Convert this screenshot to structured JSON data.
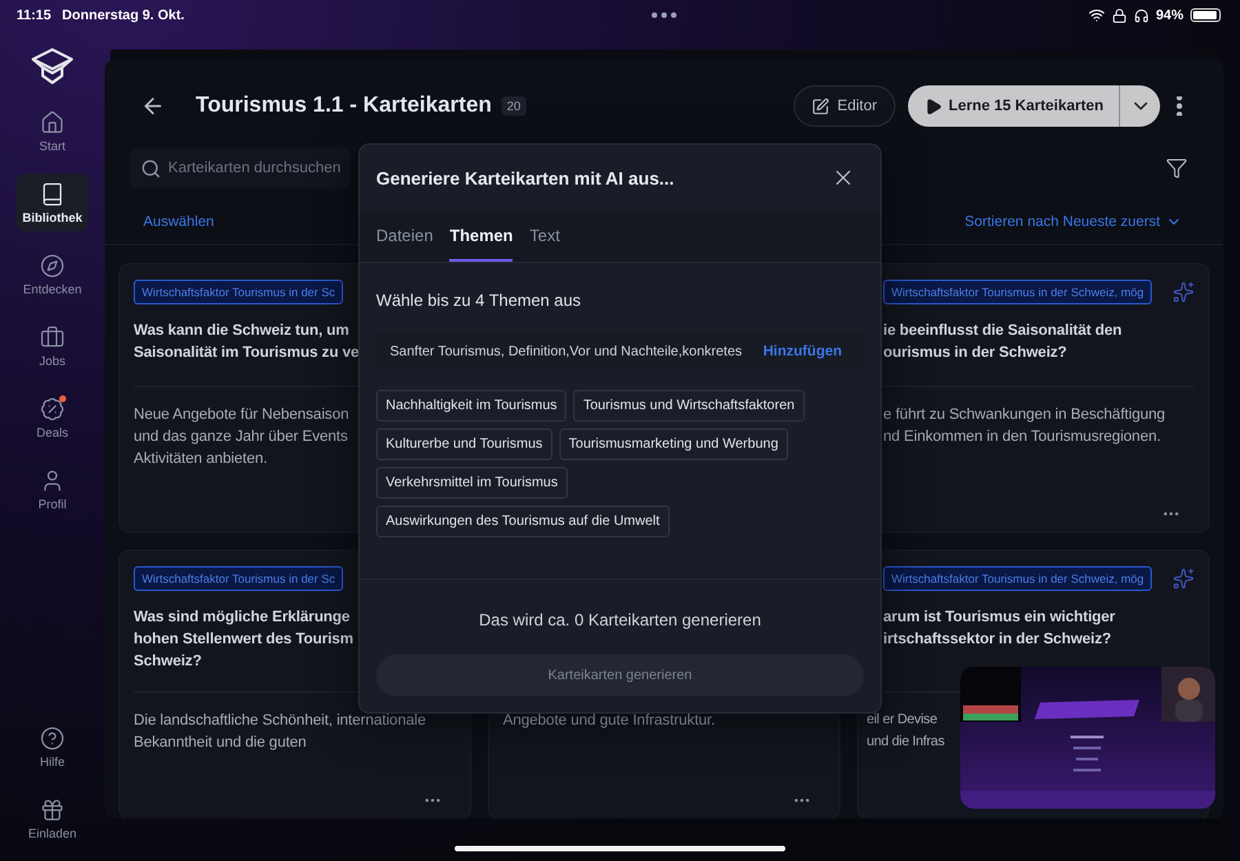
{
  "status_bar": {
    "time": "11:15",
    "date": "Donnerstag 9. Okt.",
    "battery": "94%"
  },
  "sidebar": {
    "items": [
      {
        "label": "Start",
        "selected": false,
        "notification": false
      },
      {
        "label": "Bibliothek",
        "selected": true,
        "notification": false
      },
      {
        "label": "Entdecken",
        "selected": false,
        "notification": false
      },
      {
        "label": "Jobs",
        "selected": false,
        "notification": false
      },
      {
        "label": "Deals",
        "selected": false,
        "notification": true
      },
      {
        "label": "Profil",
        "selected": false,
        "notification": false
      }
    ],
    "footer_items": [
      {
        "label": "Hilfe"
      },
      {
        "label": "Einladen"
      }
    ]
  },
  "header": {
    "title": "Tourismus 1.1 - Karteikarten",
    "count": "20",
    "editor_button": "Editor",
    "learn_button": "Lerne 15 Karteikarten"
  },
  "toolbar": {
    "search_placeholder": "Karteikarten durchsuchen",
    "select_link": "Auswählen",
    "sort_link": "Sortieren nach Neueste zuerst"
  },
  "cards": [
    {
      "kind": "card",
      "tag": "Wirtschaftsfaktor Tourismus in der Sc",
      "question": [
        "Was kann die Schweiz tun, um",
        "Saisonalität im Tourismus zu ve"
      ],
      "answer": [
        "Neue Angebote für Nebensaison",
        "und das ganze Jahr über Events",
        "Aktivitäten anbieten."
      ],
      "sparkle": false,
      "menu": false
    },
    {
      "kind": "covered"
    },
    {
      "kind": "card",
      "tag": "Wirtschaftsfaktor Tourismus in der Schweiz, mög",
      "question": [
        "ie beeinflusst die Saisonalität den",
        "ourismus in der Schweiz?"
      ],
      "answer": [
        "e führt zu Schwankungen in Beschäftigung",
        "nd Einkommen in den Tourismusregionen."
      ],
      "sparkle": true,
      "menu": true
    },
    {
      "kind": "card",
      "tag": "Wirtschaftsfaktor Tourismus in der Sc",
      "question": [
        "Was sind mögliche Erklärunge",
        "hohen Stellenwert des Tourism",
        "Schweiz?"
      ],
      "answer": [
        "Die landschaftliche Schönheit, internationale",
        "Bekanntheit und die guten"
      ],
      "sparkle": false,
      "menu": true
    },
    {
      "kind": "card",
      "answer": [
        "Angebote und gute Infrastruktur."
      ],
      "sparkle": false,
      "menu": true
    },
    {
      "kind": "card",
      "tag": "Wirtschaftsfaktor Tourismus in der Schweiz, mög",
      "question": [
        "arum ist Tourismus ein wichtiger",
        "irtschaftssektor in der Schweiz?"
      ],
      "answer": [
        "eil er Devise",
        "und die Infras"
      ],
      "sparkle": true,
      "menu": false
    }
  ],
  "modal": {
    "title": "Generiere Karteikarten mit AI aus...",
    "tabs": [
      {
        "label": "Dateien",
        "selected": false
      },
      {
        "label": "Themen",
        "selected": true
      },
      {
        "label": "Text",
        "selected": false
      }
    ],
    "prompt": "Wähle bis zu 4 Themen aus",
    "topic_input": {
      "value": "Sanfter Tourismus, Definition,Vor und Nachteile,konkretes"
    },
    "add_button": "Hinzufügen",
    "topics": [
      {
        "label": "Nachhaltigkeit im Tourismus",
        "selected": false
      },
      {
        "label": "Tourismus und Wirtschaftsfaktoren",
        "selected": false
      },
      {
        "label": "Kulturerbe und Tourismus",
        "selected": false
      },
      {
        "label": "Tourismusmarketing und Werbung",
        "selected": false
      },
      {
        "label": "Verkehrsmittel im Tourismus",
        "selected": false
      },
      {
        "label": "Auswirkungen des Tourismus auf die Umwelt",
        "selected": false
      }
    ],
    "estimate": "Das wird ca. 0 Karteikarten generieren",
    "generate_button": {
      "label": "Karteikarten generieren",
      "disabled": true
    }
  }
}
